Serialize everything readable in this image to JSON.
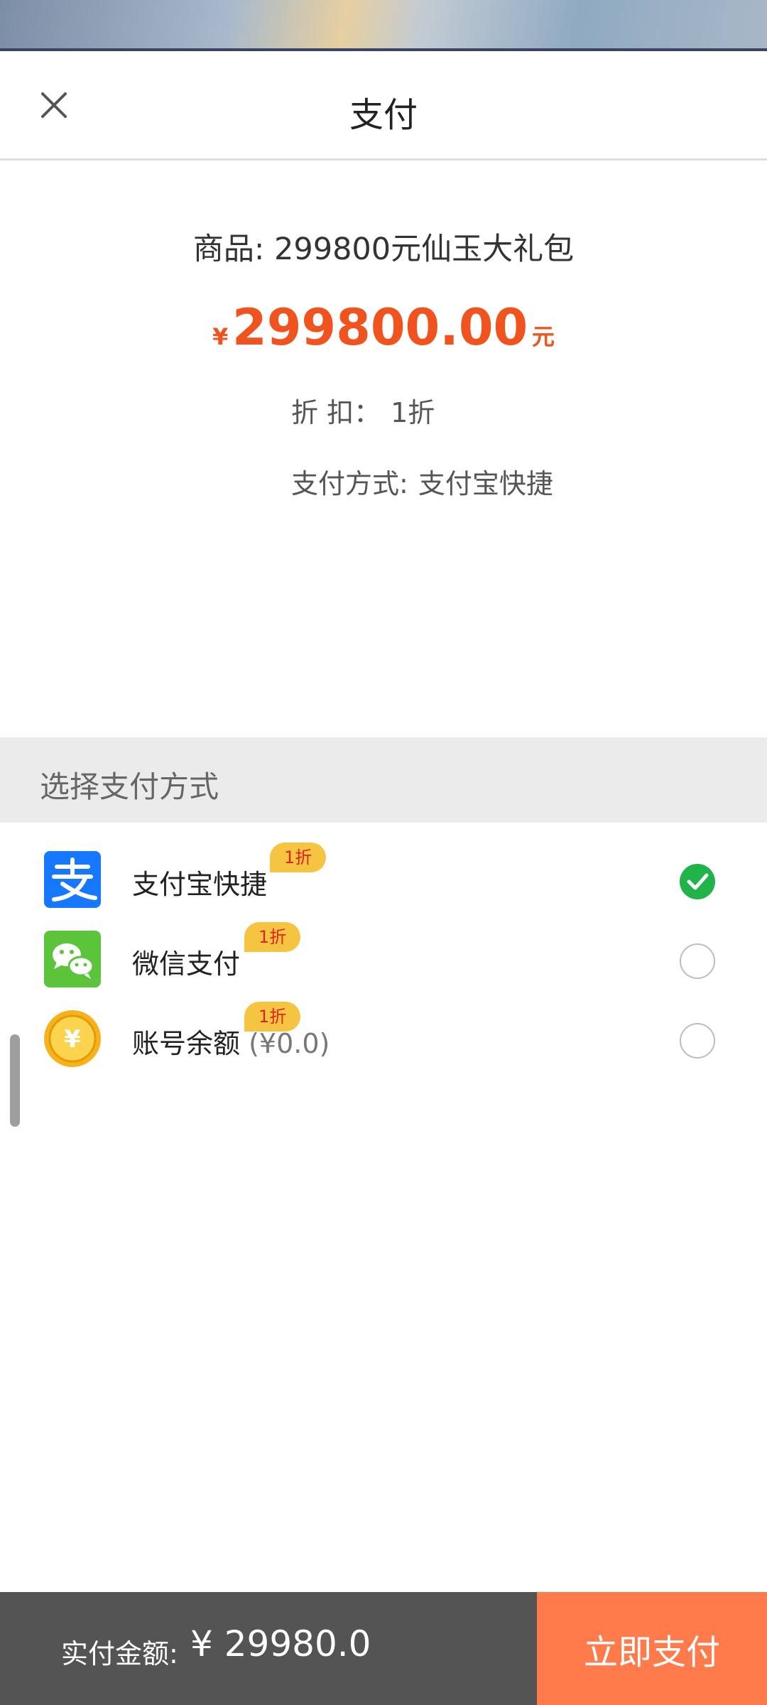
{
  "header": {
    "title": "支付",
    "close_icon": "close-icon"
  },
  "product": {
    "name": "商品: 299800元仙玉大礼包",
    "price_currency": "¥",
    "price_amount": "299800.00",
    "price_unit": "元",
    "discount_label": "折 扣：",
    "discount_value": "1折",
    "method_label": "支付方式:",
    "method_value": "支付宝快捷"
  },
  "section": {
    "title": "选择支付方式"
  },
  "payment_methods": [
    {
      "label": "支付宝快捷",
      "extra": "",
      "badge": "1折",
      "icon": "alipay-icon",
      "selected": true
    },
    {
      "label": "微信支付",
      "extra": "",
      "badge": "1折",
      "icon": "wechat-icon",
      "selected": false
    },
    {
      "label": "账号余额",
      "extra": "(¥0.0)",
      "badge": "1折",
      "icon": "coin-icon",
      "selected": false
    }
  ],
  "footer": {
    "total_label": "实付金额:",
    "total_value": "¥ 29980.0",
    "pay_button": "立即支付"
  },
  "colors": {
    "accent": "#f0531d",
    "pay_button": "#ff7b4c",
    "bottom_bar": "#545454",
    "badge": "#f5c542",
    "check": "#1fb34a"
  }
}
